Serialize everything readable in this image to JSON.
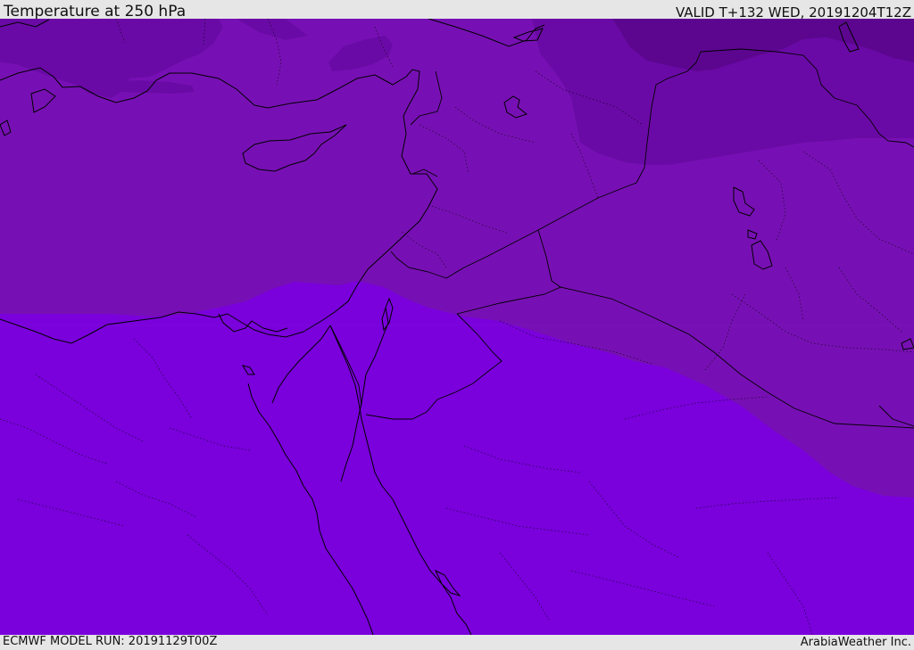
{
  "header": {
    "title": "Temperature at 250 hPa",
    "valid_time": "VALID T+132 WED, 20191204T12Z"
  },
  "footer": {
    "model_run": "ECMWF MODEL RUN: 20191129T00Z",
    "credit": "ArabiaWeather Inc."
  },
  "map": {
    "variable": "temperature",
    "level": "250 hPa",
    "colors": {
      "band_warm": "#7a00dc",
      "band_mid": "#7710b4",
      "band_cool": "#6a0aa6",
      "band_cold": "#5c0690",
      "outline": "#000000"
    }
  }
}
